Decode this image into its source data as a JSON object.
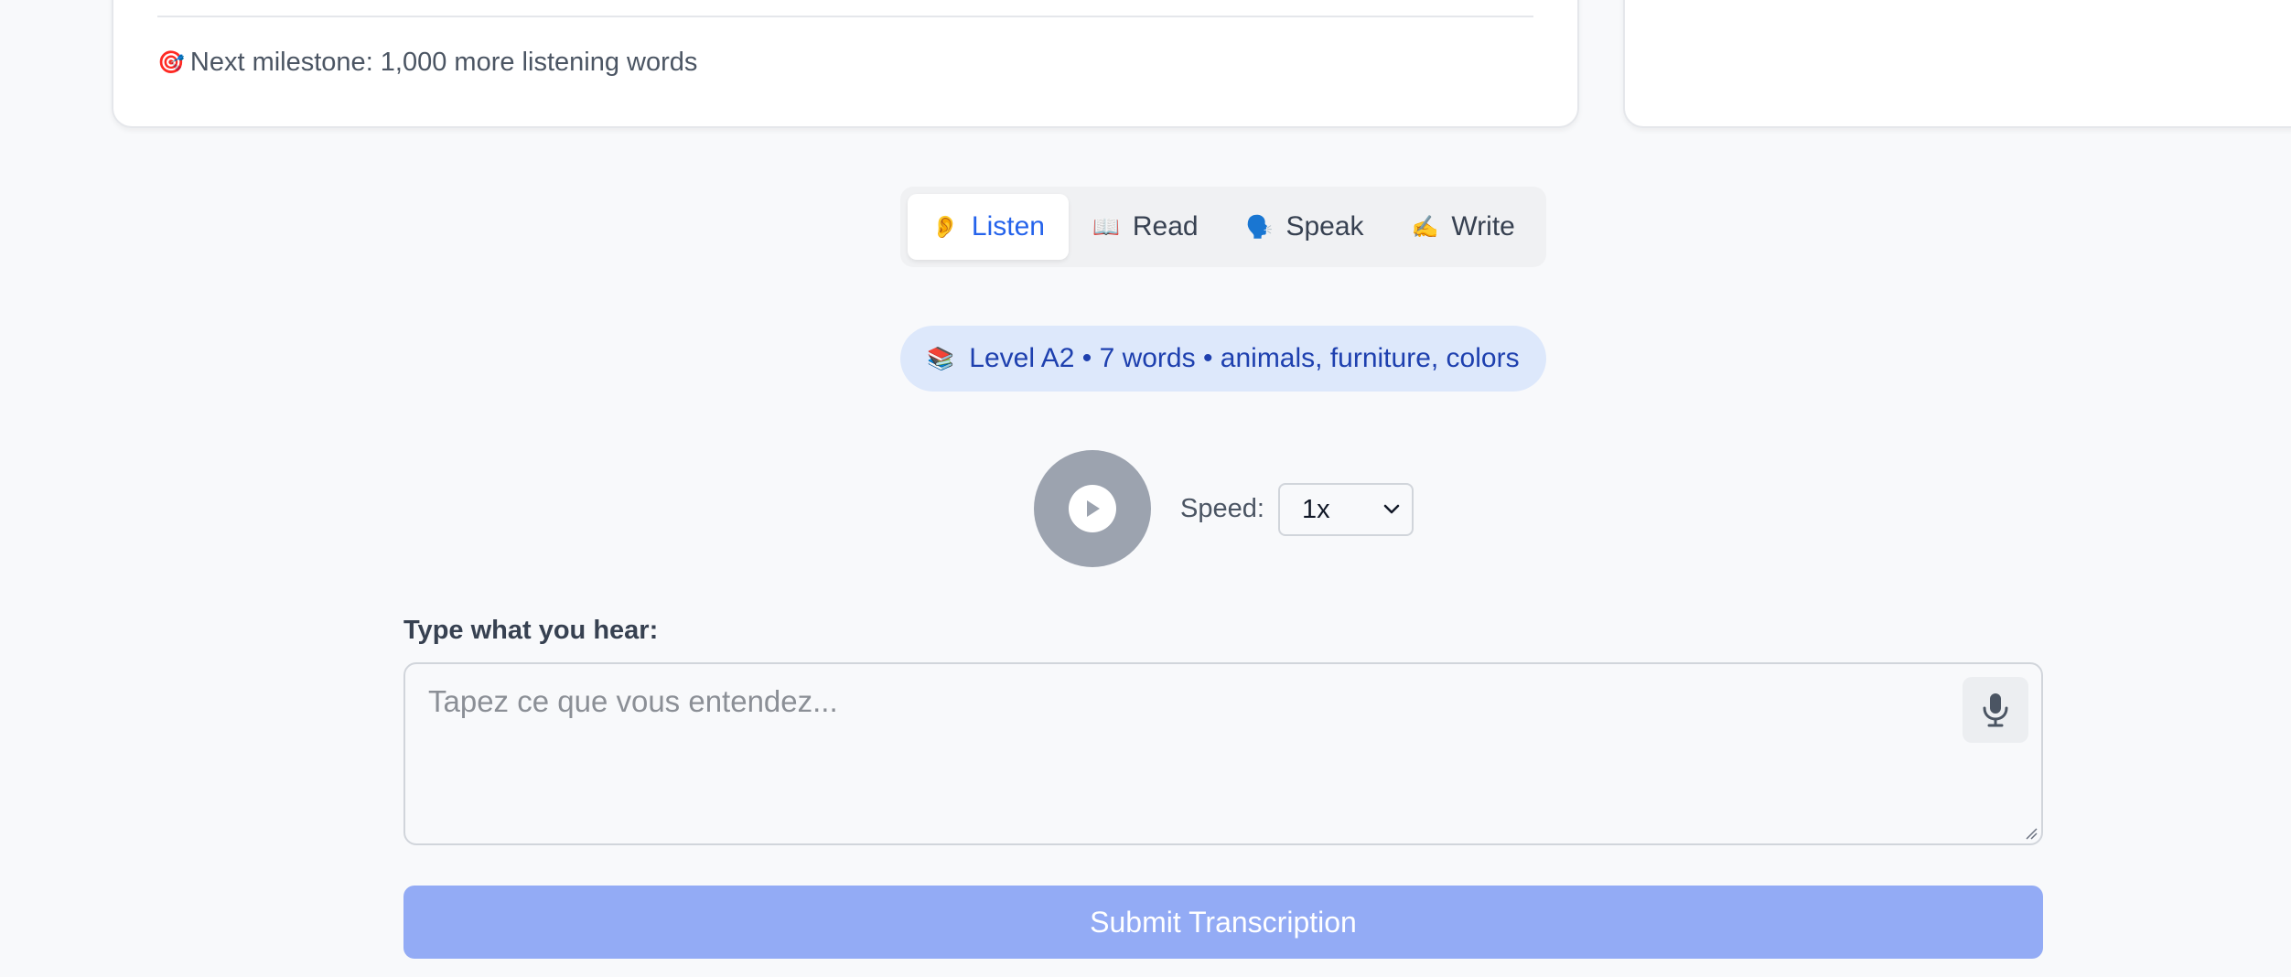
{
  "progress_card": {
    "milestone_icon": "dart-target-icon",
    "milestone_emoji": "🎯",
    "milestone_text": "Next milestone: 1,000 more listening words"
  },
  "tabs": [
    {
      "id": "listen",
      "emoji": "👂",
      "icon": "ear-icon",
      "label": "Listen",
      "active": true
    },
    {
      "id": "read",
      "emoji": "📖",
      "icon": "book-icon",
      "label": "Read",
      "active": false
    },
    {
      "id": "speak",
      "emoji": "🗣️",
      "icon": "speaking-head-icon",
      "label": "Speak",
      "active": false
    },
    {
      "id": "write",
      "emoji": "✍️",
      "icon": "writing-hand-icon",
      "label": "Write",
      "active": false
    }
  ],
  "level_pill": {
    "emoji": "📚",
    "icon": "books-icon",
    "text": "Level A2 • 7 words • animals, furniture, colors"
  },
  "audio": {
    "play_icon": "play-icon",
    "speed_label": "Speed:",
    "speed_value": "1x"
  },
  "transcription": {
    "label": "Type what you hear:",
    "placeholder": "Tapez ce que vous entendez...",
    "value": "",
    "mic_icon": "microphone-icon",
    "submit_label": "Submit Transcription"
  },
  "colors": {
    "accent": "#2563eb",
    "pill_bg": "#dde8fb",
    "pill_text": "#1e40af",
    "submit_bg": "#93abf5",
    "play_bg": "#9ca3af"
  }
}
